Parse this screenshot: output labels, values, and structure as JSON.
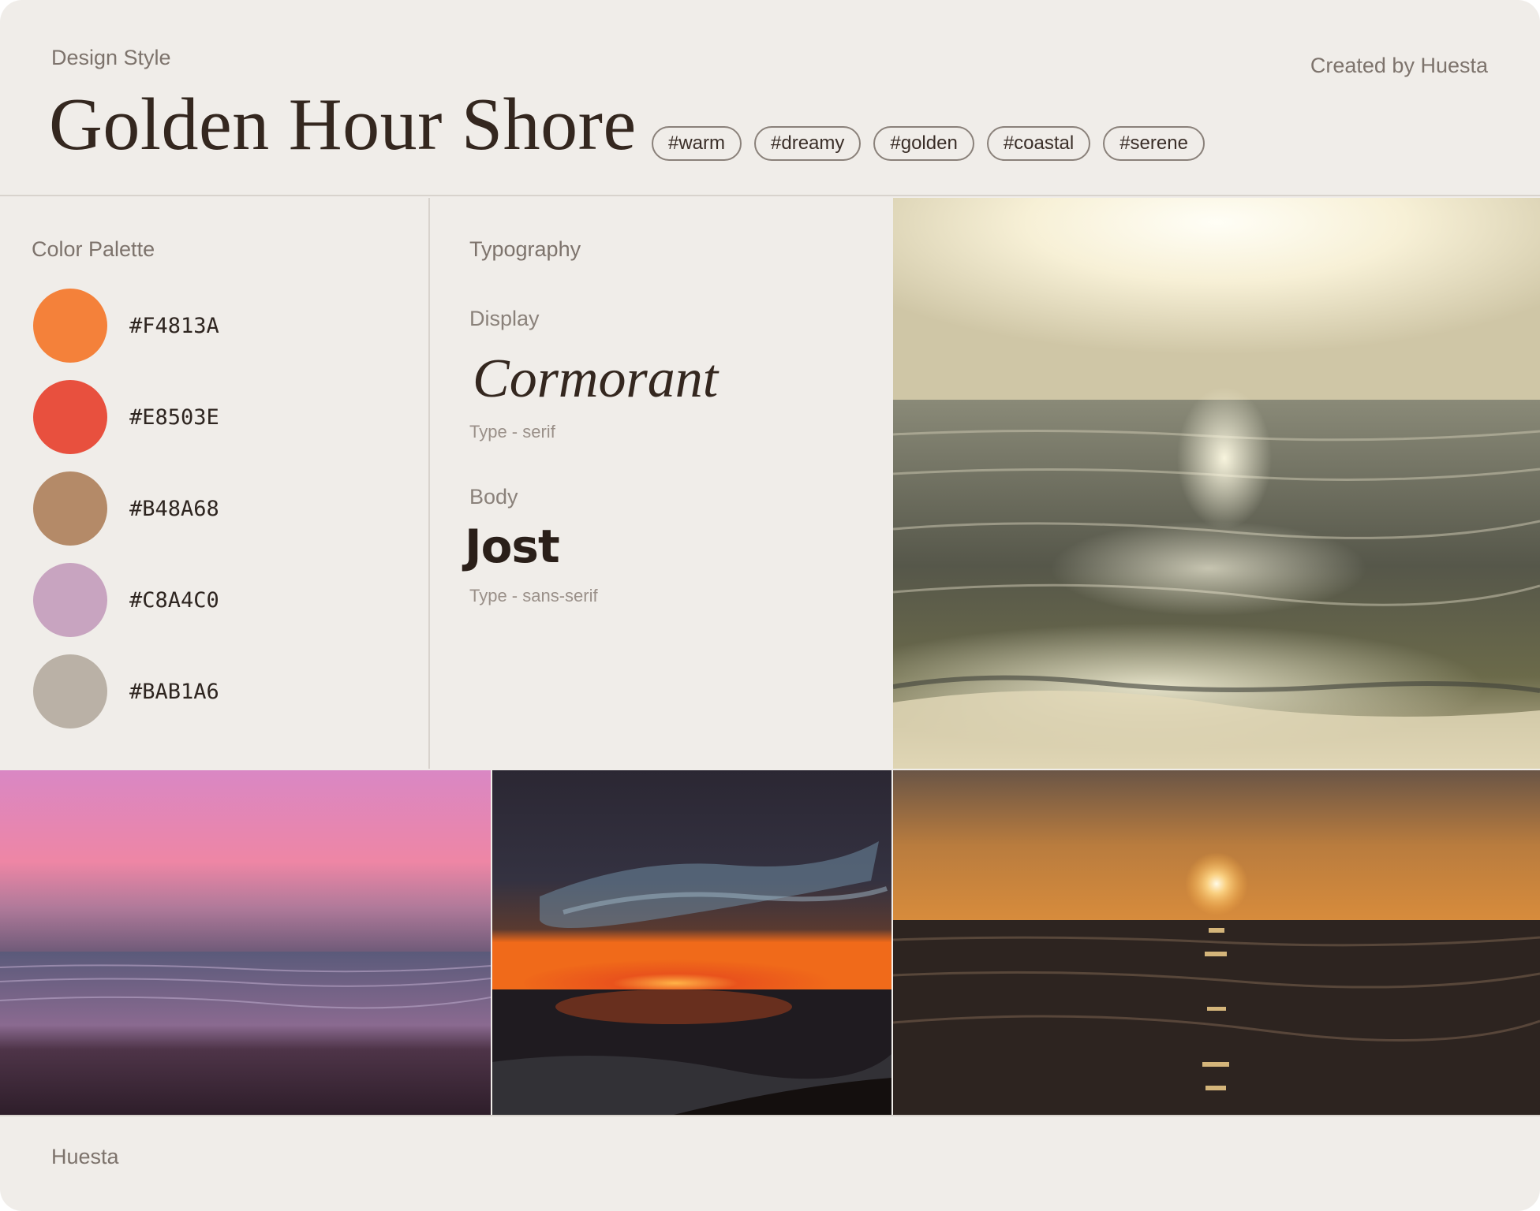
{
  "header": {
    "eyebrow": "Design Style",
    "title": "Golden Hour Shore",
    "tags": [
      "#warm",
      "#dreamy",
      "#golden",
      "#coastal",
      "#serene"
    ],
    "credit": "Created by Huesta"
  },
  "palette": {
    "label": "Color Palette",
    "colors": [
      {
        "hex": "#F4813A",
        "color": "#F4813A"
      },
      {
        "hex": "#E8503E",
        "color": "#E8503E"
      },
      {
        "hex": "#B48A68",
        "color": "#B48A68"
      },
      {
        "hex": "#C8A4C0",
        "color": "#C8A4C0"
      },
      {
        "hex": "#BAB1A6",
        "color": "#BAB1A6"
      }
    ]
  },
  "typography": {
    "label": "Typography",
    "display": {
      "label": "Display",
      "sample": "Cormorant",
      "note": "Type - serif"
    },
    "body": {
      "label": "Body",
      "sample": "Jost",
      "note": "Type - sans-serif"
    }
  },
  "footer": {
    "brand": "Huesta"
  }
}
